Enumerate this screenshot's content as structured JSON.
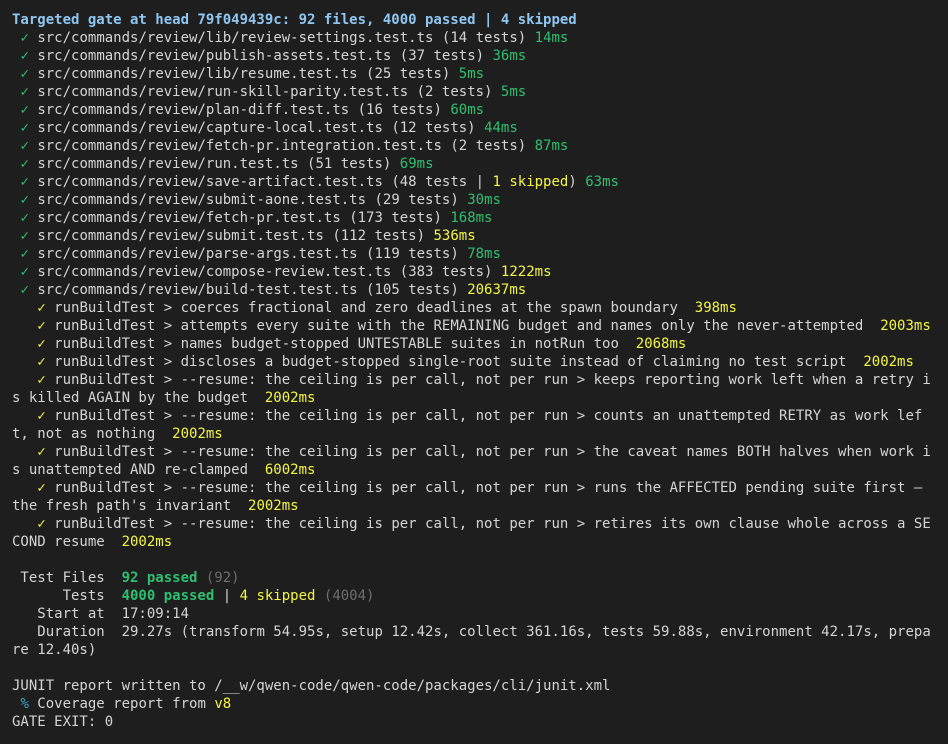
{
  "header": "Targeted gate at head 79f049439c: 92 files, 4000 passed | 4 skipped",
  "check": "✓",
  "files": [
    {
      "path": "src/commands/review/lib/review-settings.test.ts",
      "tests": "(14 tests)",
      "time": "14ms",
      "slow": false
    },
    {
      "path": "src/commands/review/publish-assets.test.ts",
      "tests": "(37 tests)",
      "time": "36ms",
      "slow": false
    },
    {
      "path": "src/commands/review/lib/resume.test.ts",
      "tests": "(25 tests)",
      "time": "5ms",
      "slow": false
    },
    {
      "path": "src/commands/review/run-skill-parity.test.ts",
      "tests": "(2 tests)",
      "time": "5ms",
      "slow": false
    },
    {
      "path": "src/commands/review/plan-diff.test.ts",
      "tests": "(16 tests)",
      "time": "60ms",
      "slow": false
    },
    {
      "path": "src/commands/review/capture-local.test.ts",
      "tests": "(12 tests)",
      "time": "44ms",
      "slow": false
    },
    {
      "path": "src/commands/review/fetch-pr.integration.test.ts",
      "tests": "(2 tests)",
      "time": "87ms",
      "slow": false
    },
    {
      "path": "src/commands/review/run.test.ts",
      "tests": "(51 tests)",
      "time": "69ms",
      "slow": false
    },
    {
      "path": "src/commands/review/save-artifact.test.ts",
      "tests": "(48 tests",
      "skipped": "1 skipped",
      "time": "63ms",
      "slow": false
    },
    {
      "path": "src/commands/review/submit-aone.test.ts",
      "tests": "(29 tests)",
      "time": "30ms",
      "slow": false
    },
    {
      "path": "src/commands/review/fetch-pr.test.ts",
      "tests": "(173 tests)",
      "time": "168ms",
      "slow": false
    },
    {
      "path": "src/commands/review/submit.test.ts",
      "tests": "(112 tests)",
      "time": "536ms",
      "slow": true
    },
    {
      "path": "src/commands/review/parse-args.test.ts",
      "tests": "(119 tests)",
      "time": "78ms",
      "slow": false
    },
    {
      "path": "src/commands/review/compose-review.test.ts",
      "tests": "(383 tests)",
      "time": "1222ms",
      "slow": true
    },
    {
      "path": "src/commands/review/build-test.test.ts",
      "tests": "(105 tests)",
      "time": "20637ms",
      "slow": true
    }
  ],
  "slow_tests": [
    {
      "text": "runBuildTest > coerces fractional and zero deadlines at the spawn boundary",
      "time": "398ms"
    },
    {
      "text": "runBuildTest > attempts every suite with the REMAINING budget and names only the never-attempted",
      "time": "2003ms"
    },
    {
      "text": "runBuildTest > names budget-stopped UNTESTABLE suites in notRun too",
      "time": "2068ms"
    },
    {
      "text": "runBuildTest > discloses a budget-stopped single-root suite instead of claiming no test script",
      "time": "2002ms"
    },
    {
      "text": "runBuildTest > --resume: the ceiling is per call, not per run > keeps reporting work left when a retry is killed AGAIN by the budget",
      "time": "2002ms"
    },
    {
      "text": "runBuildTest > --resume: the ceiling is per call, not per run > counts an unattempted RETRY as work left, not as nothing",
      "time": "2002ms"
    },
    {
      "text": "runBuildTest > --resume: the ceiling is per call, not per run > the caveat names BOTH halves when work is unattempted AND re-clamped",
      "time": "6002ms"
    },
    {
      "text": "runBuildTest > --resume: the ceiling is per call, not per run > runs the AFFECTED pending suite first — the fresh path's invariant",
      "time": "2002ms"
    },
    {
      "text": "runBuildTest > --resume: the ceiling is per call, not per run > retires its own clause whole across a SECOND resume",
      "time": "2002ms"
    }
  ],
  "summary": {
    "files_label": " Test Files  ",
    "files_passed": "92 passed",
    "files_total": "(92)",
    "tests_label": "      Tests  ",
    "tests_passed": "4000 passed",
    "tests_sep": " | ",
    "tests_skipped": "4 skipped",
    "tests_total": "(4004)",
    "start_label": "   Start at  ",
    "start_value": "17:09:14",
    "duration_label": "   Duration  ",
    "duration_value": "29.27s (transform 54.95s, setup 12.42s, collect 361.16s, tests 59.88s, environment 42.17s, prepare 12.40s)"
  },
  "junit_line": "JUNIT report written to /__w/qwen-code/qwen-code/packages/cli/junit.xml",
  "coverage": {
    "icon": "%",
    "text": " Coverage report from ",
    "provider": "v8"
  },
  "exit_line": "GATE EXIT: 0",
  "colors": {
    "background": "#1e1e1e",
    "pass_green": "#2fbf71",
    "slow_yellow": "#f5f543",
    "header_blue": "#8fc7f2"
  }
}
